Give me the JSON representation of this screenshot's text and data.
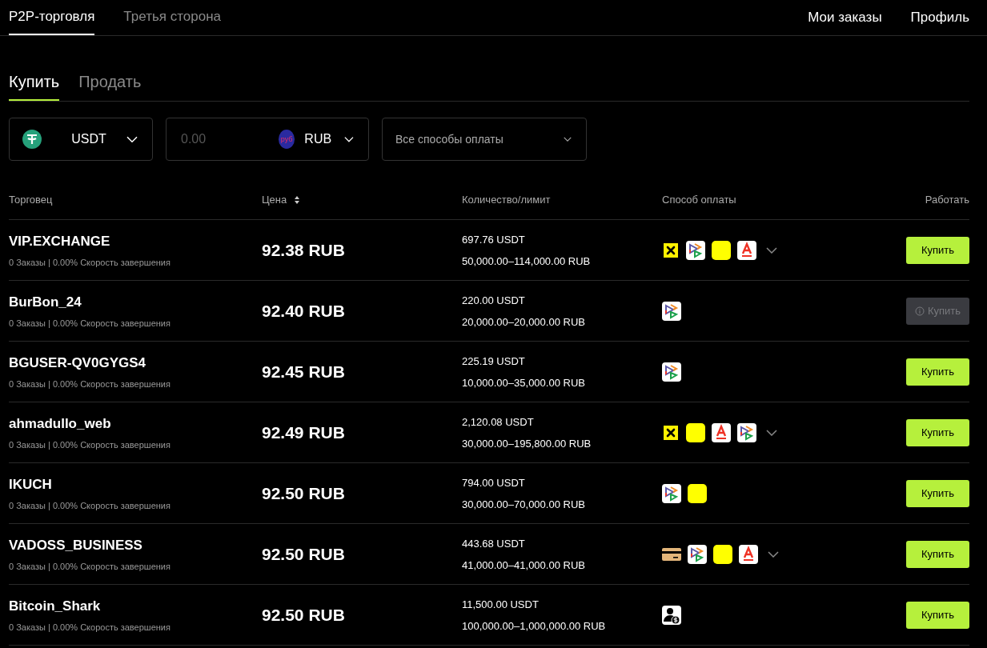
{
  "top_tabs": [
    {
      "label": "P2P-торговля",
      "selected": true
    },
    {
      "label": "Третья сторона",
      "selected": false
    }
  ],
  "top_links": [
    "Мои заказы",
    "Профиль"
  ],
  "side_tabs": [
    {
      "label": "Купить",
      "selected": true
    },
    {
      "label": "Продать",
      "selected": false
    }
  ],
  "filters": {
    "coin": "USDT",
    "amount_placeholder": "0.00",
    "currency_badge": "руб",
    "currency": "RUB",
    "payment": "Все способы оплаты"
  },
  "table": {
    "columns": [
      "Торговец",
      "Цена",
      "Количество/лимит",
      "Способ оплаты",
      "Работать"
    ],
    "rows": [
      {
        "merchant": "VIP.EXCHANGE",
        "stats": "0 Заказы | 0.00% Скорость завершения",
        "price": "92.38 RUB",
        "quantity": "697.76 USDT",
        "limit": "50,000.00–114,000.00 RUB",
        "methods": [
          {
            "kind": "raif"
          },
          {
            "kind": "sbp"
          },
          {
            "kind": "yellow"
          },
          {
            "kind": "alfa"
          }
        ],
        "more": true,
        "action": "Купить",
        "disabled": false
      },
      {
        "merchant": "BurBon_24",
        "stats": "0 Заказы | 0.00% Скорость завершения",
        "price": "92.40 RUB",
        "quantity": "220.00 USDT",
        "limit": "20,000.00–20,000.00 RUB",
        "methods": [
          {
            "kind": "sbp"
          }
        ],
        "more": false,
        "action": "Купить",
        "disabled": true
      },
      {
        "merchant": "BGUSER-QV0GYGS4",
        "stats": "0 Заказы | 0.00% Скорость завершения",
        "price": "92.45 RUB",
        "quantity": "225.19 USDT",
        "limit": "10,000.00–35,000.00 RUB",
        "methods": [
          {
            "kind": "sbp"
          }
        ],
        "more": false,
        "action": "Купить",
        "disabled": false
      },
      {
        "merchant": "ahmadullo_web",
        "stats": "0 Заказы | 0.00% Скорость завершения",
        "price": "92.49 RUB",
        "quantity": "2,120.08 USDT",
        "limit": "30,000.00–195,800.00 RUB",
        "methods": [
          {
            "kind": "raif"
          },
          {
            "kind": "yellow"
          },
          {
            "kind": "alfa"
          },
          {
            "kind": "sbp"
          }
        ],
        "more": true,
        "action": "Купить",
        "disabled": false
      },
      {
        "merchant": "IKUCH",
        "stats": "0 Заказы | 0.00% Скорость завершения",
        "price": "92.50 RUB",
        "quantity": "794.00 USDT",
        "limit": "30,000.00–70,000.00 RUB",
        "methods": [
          {
            "kind": "sbp"
          },
          {
            "kind": "yellow"
          }
        ],
        "more": false,
        "action": "Купить",
        "disabled": false
      },
      {
        "merchant": "VADOSS_BUSINESS",
        "stats": "0 Заказы | 0.00% Скорость завершения",
        "price": "92.50 RUB",
        "quantity": "443.68 USDT",
        "limit": "41,000.00–41,000.00 RUB",
        "methods": [
          {
            "kind": "card"
          },
          {
            "kind": "sbp"
          },
          {
            "kind": "yellow"
          },
          {
            "kind": "alfa"
          }
        ],
        "more": true,
        "action": "Купить",
        "disabled": false
      },
      {
        "merchant": "Bitcoin_Shark",
        "stats": "0 Заказы | 0.00% Скорость завершения",
        "price": "92.50 RUB",
        "quantity": "11,500.00 USDT",
        "limit": "100,000.00–1,000,000.00 RUB",
        "methods": [
          {
            "kind": "person"
          }
        ],
        "more": false,
        "action": "Купить",
        "disabled": false
      }
    ]
  }
}
